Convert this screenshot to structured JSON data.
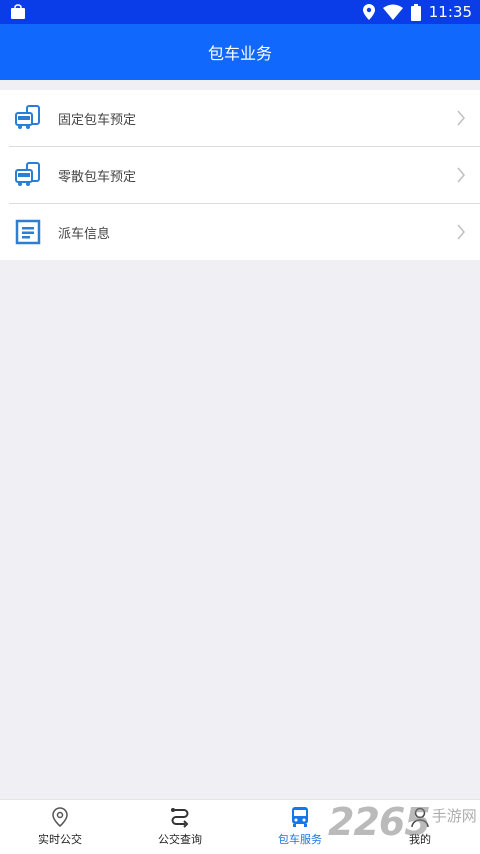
{
  "status_bar": {
    "time": "11:35"
  },
  "header": {
    "title": "包车业务"
  },
  "menu": {
    "items": [
      {
        "label": "固定包车预定",
        "icon": "bus-phone-icon"
      },
      {
        "label": "零散包车预定",
        "icon": "bus-phone-icon"
      },
      {
        "label": "派车信息",
        "icon": "document-icon"
      }
    ]
  },
  "tabbar": {
    "tabs": [
      {
        "label": "实时公交",
        "icon": "location-pin-icon",
        "active": false
      },
      {
        "label": "公交查询",
        "icon": "route-icon",
        "active": false
      },
      {
        "label": "包车服务",
        "icon": "bus-icon",
        "active": true
      },
      {
        "label": "我的",
        "icon": "person-icon",
        "active": false
      }
    ]
  },
  "watermark": {
    "number": "2265",
    "text": "手游网"
  },
  "colors": {
    "status_bar": "#0a3de8",
    "header": "#1068fc",
    "accent": "#1877e6",
    "background": "#efeff4"
  }
}
